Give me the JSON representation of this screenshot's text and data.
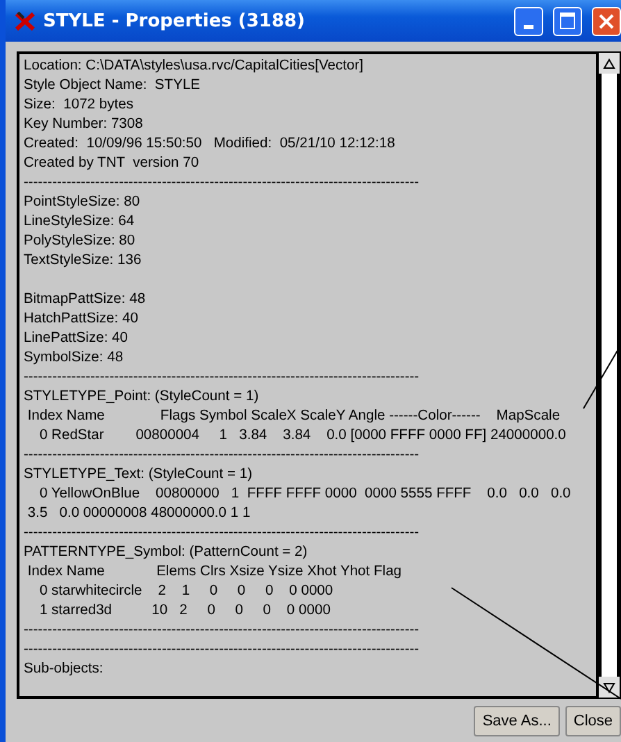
{
  "window": {
    "title": "STYLE - Properties (3188)"
  },
  "content": {
    "lines": [
      {
        "kind": "text",
        "text": "Location: C:\\DATA\\styles\\usa.rvc/CapitalCities[Vector]"
      },
      {
        "kind": "text",
        "text": "Style Object Name:  STYLE"
      },
      {
        "kind": "text",
        "text": "Size:  1072 bytes"
      },
      {
        "kind": "text",
        "text": "Key Number: 7308"
      },
      {
        "kind": "text",
        "text": "Created:  10/09/96 15:50:50   Modified:  05/21/10 12:12:18"
      },
      {
        "kind": "text",
        "text": "Created by TNT  version 70"
      },
      {
        "kind": "text",
        "text": "-----------------------------------------------------------------------------------"
      },
      {
        "kind": "text",
        "text": "PointStyleSize: 80"
      },
      {
        "kind": "text",
        "text": "LineStyleSize: 64"
      },
      {
        "kind": "text",
        "text": "PolyStyleSize: 80"
      },
      {
        "kind": "text",
        "text": "TextStyleSize: 136"
      },
      {
        "kind": "blank"
      },
      {
        "kind": "text",
        "text": "BitmapPattSize: 48"
      },
      {
        "kind": "text",
        "text": "HatchPattSize: 40"
      },
      {
        "kind": "text",
        "text": "LinePattSize: 40"
      },
      {
        "kind": "text",
        "text": "SymbolSize: 48"
      },
      {
        "kind": "text",
        "text": "-----------------------------------------------------------------------------------"
      },
      {
        "kind": "text",
        "text": "STYLETYPE_Point: (StyleCount = 1)"
      },
      {
        "kind": "text",
        "text": " Index Name              Flags Symbol ScaleX ScaleY Angle ------Color------    MapScale"
      },
      {
        "kind": "text",
        "text": "    0 RedStar        00800004     1   3.84    3.84    0.0 [0000 FFFF 0000 FF] 24000000.0"
      },
      {
        "kind": "text",
        "text": "-----------------------------------------------------------------------------------"
      },
      {
        "kind": "text",
        "text": "STYLETYPE_Text: (StyleCount = 1)"
      },
      {
        "kind": "text",
        "text": "    0 YellowOnBlue    00800000   1  FFFF FFFF 0000  0000 5555 FFFF    0.0   0.0   0.0"
      },
      {
        "kind": "text",
        "text": " 3.5   0.0 00000008 48000000.0 1 1"
      },
      {
        "kind": "text",
        "text": "-----------------------------------------------------------------------------------"
      },
      {
        "kind": "text",
        "text": "PATTERNTYPE_Symbol: (PatternCount = 2)"
      },
      {
        "kind": "text",
        "text": " Index Name             Elems Clrs Xsize Ysize Xhot Yhot Flag"
      },
      {
        "kind": "text",
        "text": "    0 starwhitecircle    2    1     0     0     0    0 0000"
      },
      {
        "kind": "text",
        "text": "    1 starred3d          10   2     0     0     0    0 0000"
      },
      {
        "kind": "text",
        "text": "-----------------------------------------------------------------------------------"
      },
      {
        "kind": "text",
        "text": "-----------------------------------------------------------------------------------"
      },
      {
        "kind": "text",
        "text": "Sub-objects:"
      }
    ]
  },
  "buttons": [
    {
      "label": "Save As..."
    },
    {
      "label": "Close"
    }
  ]
}
